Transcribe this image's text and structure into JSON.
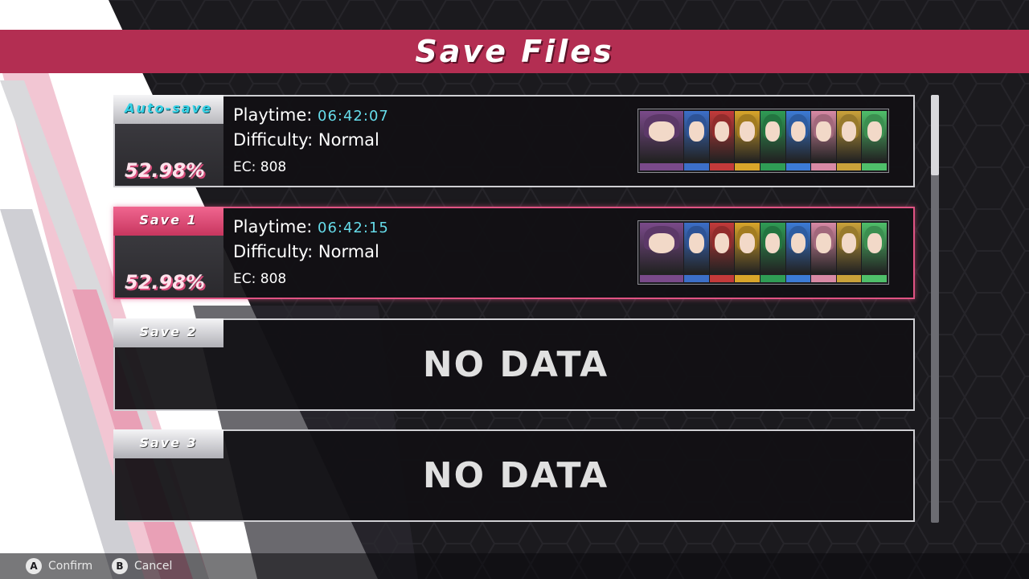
{
  "title": "Save Files",
  "slots": [
    {
      "tag": "Auto-save",
      "percent": "52.98%",
      "playtime_label": "Playtime:",
      "playtime": "06:42:07",
      "difficulty_label": "Difficulty:",
      "difficulty": "Normal",
      "ec_label": "EC:",
      "ec": "808",
      "party_colors": [
        "#7a4a8a",
        "#3c6fc8",
        "#c33a3a",
        "#d9a52a",
        "#2f9c55",
        "#3c7bd6",
        "#d88aa5",
        "#caa23a",
        "#4fbf6a"
      ]
    },
    {
      "tag": "Save 1",
      "percent": "52.98%",
      "playtime_label": "Playtime:",
      "playtime": "06:42:15",
      "difficulty_label": "Difficulty:",
      "difficulty": "Normal",
      "ec_label": "EC:",
      "ec": "808",
      "party_colors": [
        "#7a4a8a",
        "#3c6fc8",
        "#c33a3a",
        "#d9a52a",
        "#2f9c55",
        "#3c7bd6",
        "#d88aa5",
        "#caa23a",
        "#4fbf6a"
      ]
    },
    {
      "tag": "Save 2",
      "empty_text": "NO DATA"
    },
    {
      "tag": "Save 3",
      "empty_text": "NO DATA"
    }
  ],
  "footer": {
    "confirm_key": "A",
    "confirm_label": "Confirm",
    "cancel_key": "B",
    "cancel_label": "Cancel"
  },
  "colors": {
    "accent": "#b32e52",
    "selected_border": "#e05383",
    "value_text": "#66dcea"
  },
  "icons": [
    "a-button-icon",
    "b-button-icon"
  ],
  "selected_slot": 1
}
